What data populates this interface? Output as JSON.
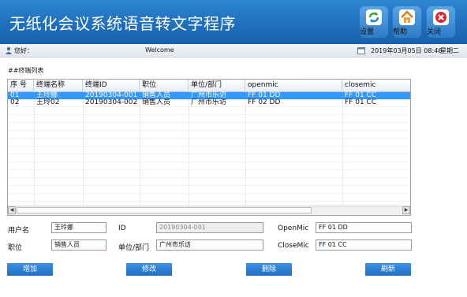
{
  "header": {
    "title": "无纸化会议系统语音转文字程序",
    "buttons": [
      {
        "label": "设置",
        "icon": "refresh-icon"
      },
      {
        "label": "帮助",
        "icon": "home-icon"
      },
      {
        "label": "关闭",
        "icon": "close-icon"
      }
    ]
  },
  "status": {
    "greeting": "您好：",
    "welcome": "Welcome",
    "datetime": "2019年03月05日 08:46",
    "weekday": "星期二"
  },
  "section_title": "##终端列表",
  "table": {
    "columns": [
      "序 号",
      "终端名称",
      "终端ID",
      "职位",
      "单位/部门",
      "openmic",
      "closemic"
    ],
    "rows": [
      [
        "01",
        "王玲娜",
        "20190304-001",
        "销售人员",
        "广州市乐访",
        "FF 01 DD",
        "FF 01 CC"
      ],
      [
        "02",
        "王玲02",
        "20190304-002",
        "销售人员",
        "广州市乐访",
        "FF 02 DD",
        "FF 01 CC"
      ]
    ],
    "selected_index": 0
  },
  "form": {
    "username_label": "用户名",
    "username_value": "王玲娜",
    "id_label": "ID",
    "id_value": "20190304-001",
    "openmic_label": "OpenMic",
    "openmic_value": "FF 01 DD",
    "position_label": "职位",
    "position_value": "销售人员",
    "dept_label": "单位/部门",
    "dept_value": "广州市乐访",
    "closemic_label": "CloseMic",
    "closemic_value": "FF 01 CC"
  },
  "actions": {
    "add": "增加",
    "edit": "修改",
    "delete": "删除",
    "refresh": "刷新"
  },
  "colors": {
    "header_blue": "#1f6fbc",
    "selection": "#3399ff",
    "button_blue": "#2a7dd2",
    "close_red": "#e0262e"
  }
}
